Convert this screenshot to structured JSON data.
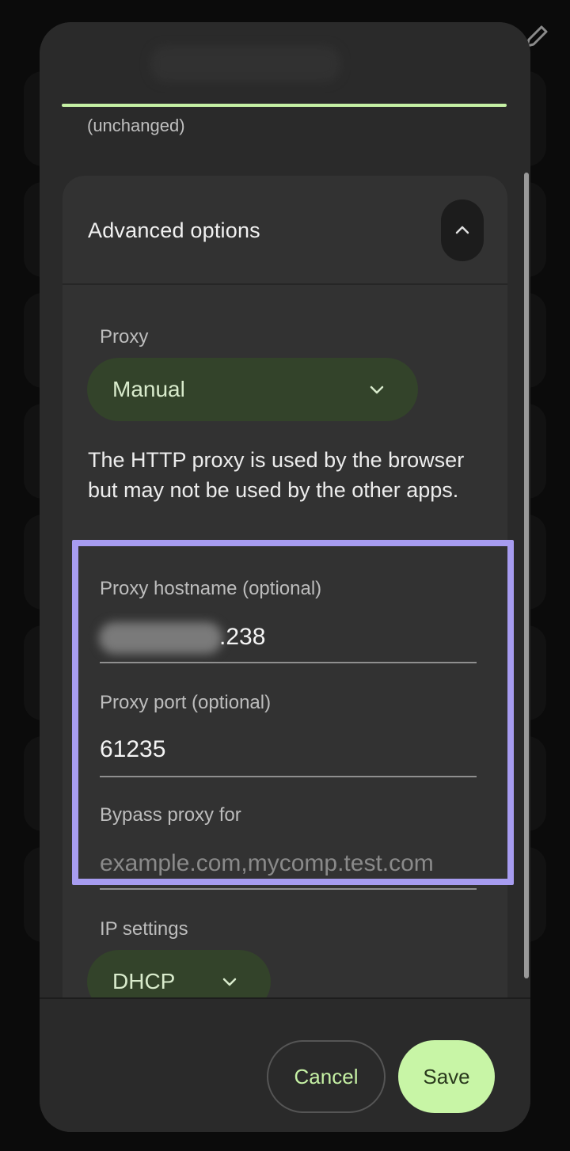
{
  "status": {
    "unchanged_text": "(unchanged)"
  },
  "advanced": {
    "title": "Advanced options",
    "proxy": {
      "label": "Proxy",
      "selected": "Manual"
    },
    "info_text": "The HTTP proxy is used by the browser but may not be used by the other apps.",
    "hostname": {
      "label": "Proxy hostname (optional)",
      "value_visible": ".238"
    },
    "port": {
      "label": "Proxy port (optional)",
      "value": "61235"
    },
    "bypass": {
      "label": "Bypass proxy for",
      "placeholder": "example.com,mycomp.test.com"
    },
    "ip_settings": {
      "label": "IP settings",
      "selected": "DHCP"
    }
  },
  "footer": {
    "cancel_label": "Cancel",
    "save_label": "Save"
  },
  "icons": {
    "edit": "pencil-icon",
    "collapse": "chevron-up-icon",
    "dropdown": "chevron-down-icon"
  },
  "colors": {
    "accent": "#c5f0a4",
    "dropdown_bg": "#33432a",
    "highlight": "#a79cf0"
  }
}
